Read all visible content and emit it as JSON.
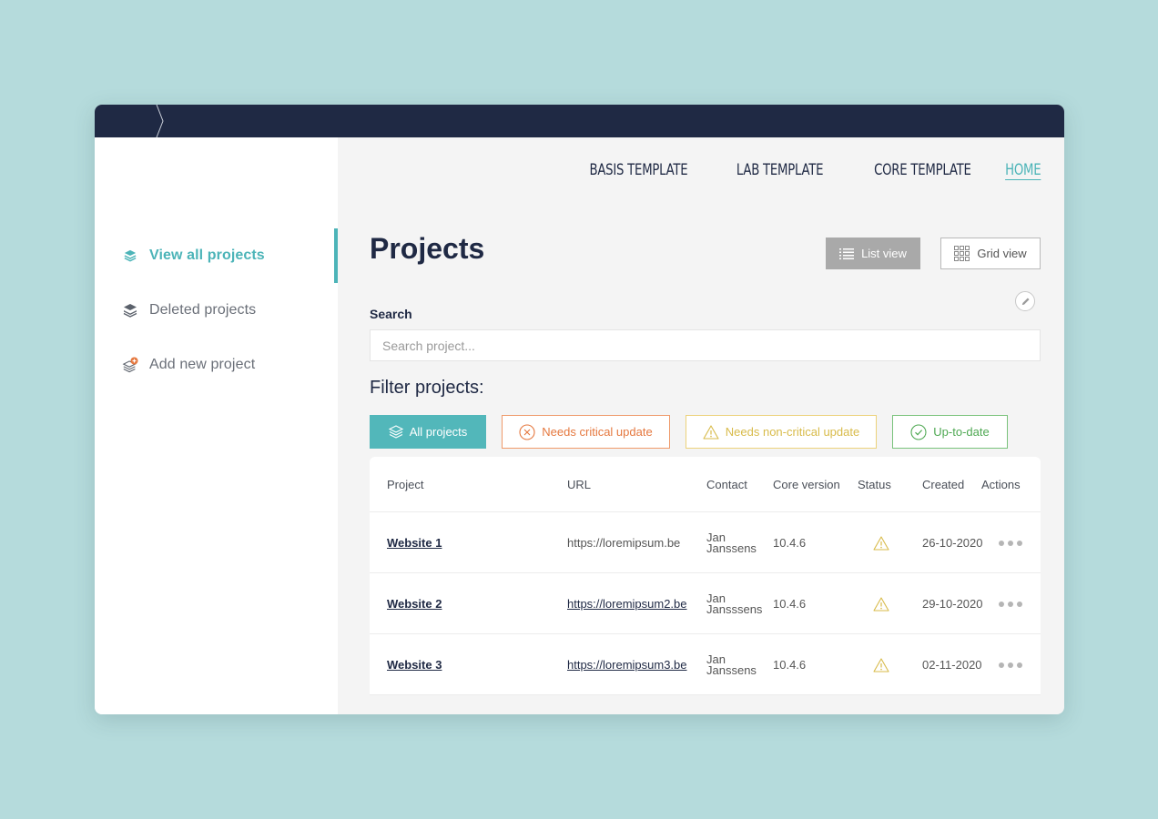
{
  "sidebar": {
    "items": [
      {
        "label": "View all projects",
        "icon": "layers-icon",
        "active": true
      },
      {
        "label": "Deleted projects",
        "icon": "layers-icon"
      },
      {
        "label": "Add new project",
        "icon": "add-layers-icon"
      }
    ]
  },
  "topnav": [
    {
      "label": "BASIS TEMPLATE"
    },
    {
      "label": "LAB TEMPLATE"
    },
    {
      "label": "CORE TEMPLATE"
    },
    {
      "label": "HOME",
      "active": true
    }
  ],
  "page": {
    "title": "Projects",
    "list_view_label": "List view",
    "grid_view_label": "Grid view"
  },
  "search": {
    "label": "Search",
    "placeholder": "Search project..."
  },
  "filters": {
    "title": "Filter projects:",
    "all": "All projects",
    "critical": "Needs critical update",
    "noncritical": "Needs non-critical update",
    "uptodate": "Up-to-date"
  },
  "table": {
    "headers": {
      "project": "Project",
      "url": "URL",
      "contact": "Contact",
      "core": "Core version",
      "status": "Status",
      "created": "Created",
      "actions": "Actions"
    },
    "rows": [
      {
        "project": "Website 1",
        "url": "https://loremipsum.be",
        "contact": "Jan Janssens",
        "core": "10.4.6",
        "status": "warning-icon",
        "created": "26-10-2020"
      },
      {
        "project": "Website 2",
        "url": "https://loremipsum2.be",
        "contact": "Jan Jansssens",
        "core": "10.4.6",
        "status": "warning-icon",
        "created": "29-10-2020"
      },
      {
        "project": "Website 3",
        "url": "https://loremipsum3.be",
        "contact": "Jan Janssens",
        "core": "10.4.6",
        "status": "warning-icon",
        "created": "02-11-2020"
      }
    ]
  },
  "colors": {
    "accent": "#4cb4b8",
    "navy": "#1f2944",
    "critical": "#e5783f",
    "noncritical": "#d8bb4a",
    "uptodate": "#4ea852",
    "background": "#b5dbdc"
  }
}
